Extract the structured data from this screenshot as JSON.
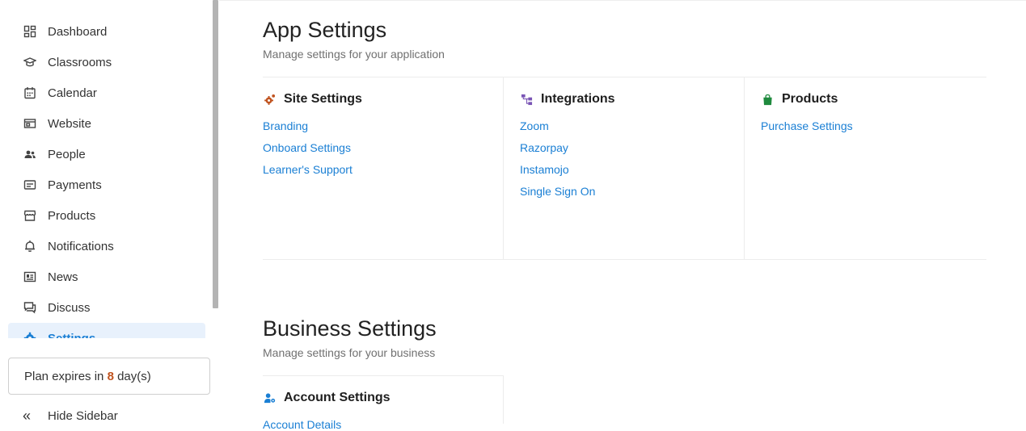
{
  "sidebar": {
    "items": [
      {
        "label": "Dashboard",
        "icon": "dashboard-icon"
      },
      {
        "label": "Classrooms",
        "icon": "graduation-cap-icon"
      },
      {
        "label": "Calendar",
        "icon": "calendar-icon"
      },
      {
        "label": "Website",
        "icon": "website-icon"
      },
      {
        "label": "People",
        "icon": "people-icon"
      },
      {
        "label": "Payments",
        "icon": "payments-icon"
      },
      {
        "label": "Products",
        "icon": "store-icon"
      },
      {
        "label": "Notifications",
        "icon": "bell-icon"
      },
      {
        "label": "News",
        "icon": "news-icon"
      },
      {
        "label": "Discuss",
        "icon": "chat-icon"
      },
      {
        "label": "Settings",
        "icon": "gear-icon",
        "active": true
      }
    ],
    "plan": {
      "prefix": "Plan expires in",
      "days": "8",
      "suffix": "day(s)"
    },
    "hide_label": "Hide Sidebar"
  },
  "app_settings": {
    "title": "App Settings",
    "subtitle": "Manage settings for your application",
    "site": {
      "title": "Site Settings",
      "links": [
        "Branding",
        "Onboard Settings",
        "Learner's Support"
      ]
    },
    "integrations": {
      "title": "Integrations",
      "links": [
        "Zoom",
        "Razorpay",
        "Instamojo",
        "Single Sign On"
      ]
    },
    "products": {
      "title": "Products",
      "links": [
        "Purchase Settings"
      ]
    }
  },
  "business_settings": {
    "title": "Business Settings",
    "subtitle": "Manage settings for your business",
    "account": {
      "title": "Account Settings",
      "links": [
        "Account Details"
      ]
    }
  },
  "colors": {
    "accent": "#1a7fd4",
    "active_bg": "#e8f1fc",
    "plan_days": "#c0531f",
    "site_icon": "#c0531f",
    "integrations_icon": "#7a55b5",
    "products_icon": "#1f8a3e"
  }
}
